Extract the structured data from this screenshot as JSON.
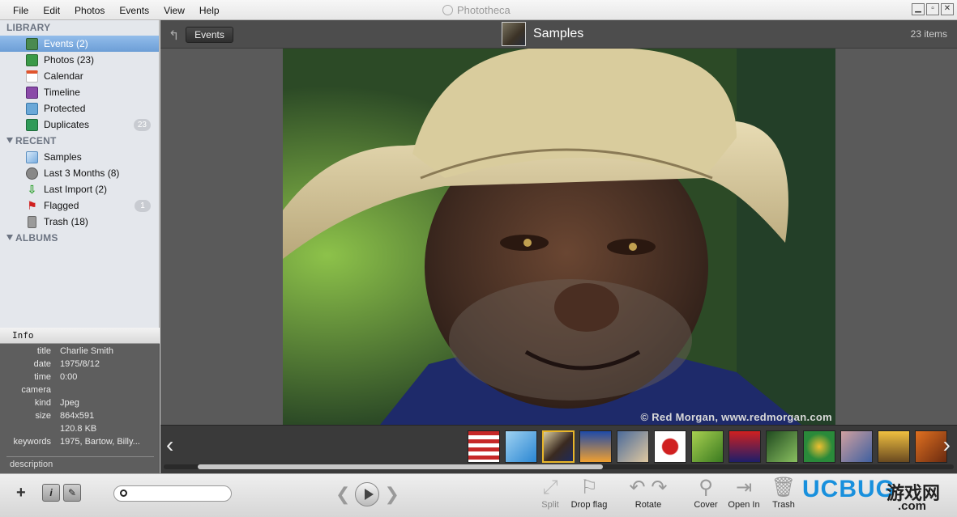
{
  "menu": [
    "File",
    "Edit",
    "Photos",
    "Events",
    "View",
    "Help"
  ],
  "window_title": "Phototheca",
  "window_controls": [
    "minimize",
    "maximize",
    "close"
  ],
  "sidebar": {
    "library_header": "LIBRARY",
    "library": [
      {
        "label": "Events (2)",
        "icon": "events-icon",
        "selected": true
      },
      {
        "label": "Photos (23)",
        "icon": "photos-icon"
      },
      {
        "label": "Calendar",
        "icon": "calendar-icon"
      },
      {
        "label": "Timeline",
        "icon": "timeline-icon"
      },
      {
        "label": "Protected",
        "icon": "protected-icon"
      },
      {
        "label": "Duplicates",
        "icon": "duplicates-icon",
        "badge": "23"
      }
    ],
    "recent_header": "RECENT",
    "recent": [
      {
        "label": "Samples",
        "icon": "samples-icon"
      },
      {
        "label": "Last 3 Months (8)",
        "icon": "clock-icon"
      },
      {
        "label": "Last Import (2)",
        "icon": "import-icon"
      },
      {
        "label": "Flagged",
        "icon": "flag-icon",
        "badge": "1"
      },
      {
        "label": "Trash (18)",
        "icon": "trash-icon"
      }
    ],
    "albums_header": "ALBUMS"
  },
  "info": {
    "tab": "Info",
    "rows": [
      {
        "key": "title",
        "value": "Charlie Smith"
      },
      {
        "key": "date",
        "value": "1975/8/12"
      },
      {
        "key": "time",
        "value": "0:00"
      },
      {
        "key": "camera",
        "value": ""
      },
      {
        "key": "kind",
        "value": "Jpeg"
      },
      {
        "key": "size",
        "value": "864x591"
      },
      {
        "key": "",
        "value": "120.8 KB"
      },
      {
        "key": "keywords",
        "value": "1975, Bartow, Billy..."
      }
    ],
    "description_label": "description"
  },
  "topbar": {
    "back_button": "Events",
    "title": "Samples",
    "count": "23 items"
  },
  "photo": {
    "watermark": "© Red Morgan, www.redmorgan.com"
  },
  "filmstrip": {
    "selected_index": 2,
    "thumbs": [
      "flag-photo",
      "blue-sky-photo",
      "portrait-photo",
      "shuttle-launch-photo",
      "rainbow-photo",
      "red-flower-photo",
      "green-leaves-photo",
      "red-hat-photo",
      "green-plant-photo",
      "costume-photo",
      "crowd-photo",
      "festival-photo",
      "autumn-photo"
    ]
  },
  "bottom": {
    "search_placeholder": "",
    "tools": [
      {
        "label": "Split",
        "enabled": false
      },
      {
        "label": "Drop flag",
        "enabled": true
      },
      {
        "label": "Rotate",
        "enabled": true
      },
      {
        "label": "Cover",
        "enabled": true
      },
      {
        "label": "Open In",
        "enabled": true
      },
      {
        "label": "Trash",
        "enabled": true
      }
    ]
  },
  "watermark_logo": {
    "brand": "UCBUG",
    "cn": "游戏网",
    "domain": ".com"
  },
  "colors": {
    "selection": "#6c9ed6",
    "main_bg": "#5a5a5a",
    "strip_bg": "#3a3a3a",
    "selected_thumb_border": "#e8b62a"
  }
}
